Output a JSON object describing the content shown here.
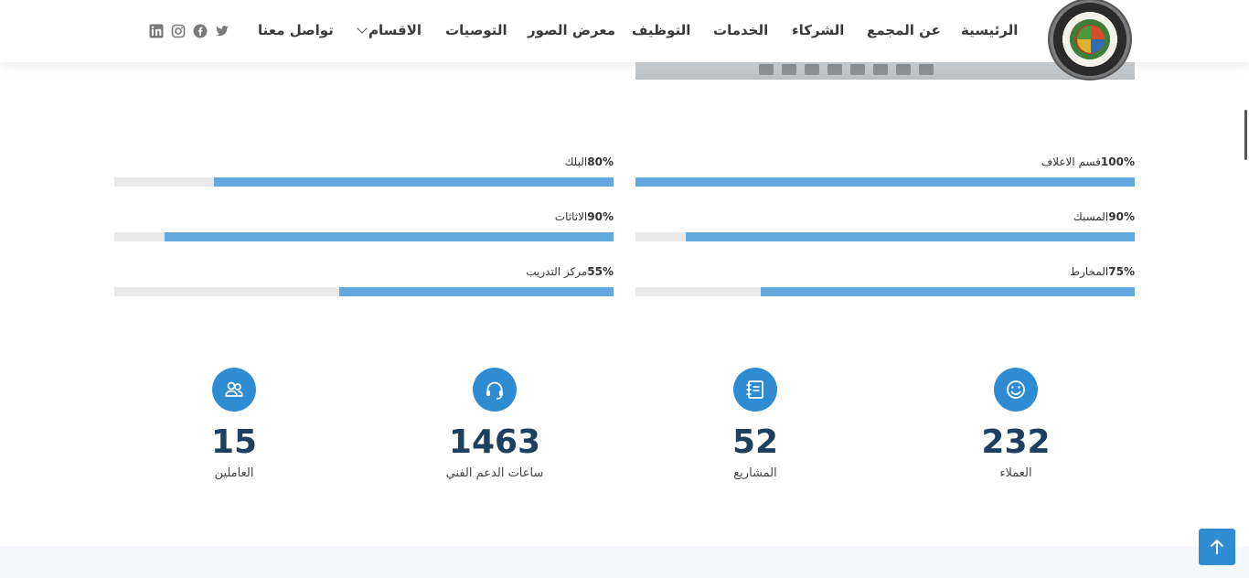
{
  "nav": {
    "home": "الرئيسية",
    "about": "عن المجمع",
    "partners": "الشركاء",
    "services": "الخدمات",
    "jobs": "التوظيف",
    "gallery": "معرض الصور",
    "recommendations": "التوصيات",
    "sections": "الاقسام",
    "contact": "تواصل معنا"
  },
  "logo": {
    "alt_text": "ATBARA PRODUCTION HALLS"
  },
  "social": [
    "twitter-icon",
    "facebook-icon",
    "instagram-icon",
    "linkedin-icon"
  ],
  "skills": [
    {
      "label": "قسم الاعلاف",
      "percent_text": "100%",
      "percent": 100
    },
    {
      "label": "البلك",
      "percent_text": "80%",
      "percent": 80
    },
    {
      "label": "المسبك",
      "percent_text": "90%",
      "percent": 90
    },
    {
      "label": "الاثاثات",
      "percent_text": "90%",
      "percent": 90
    },
    {
      "label": "المخارط",
      "percent_text": "75%",
      "percent": 75
    },
    {
      "label": "مركز التدريب",
      "percent_text": "55%",
      "percent": 55
    }
  ],
  "counters": [
    {
      "value": "232",
      "label": "العملاء",
      "icon": "smile-icon"
    },
    {
      "value": "52",
      "label": "المشاريع",
      "icon": "journal-icon"
    },
    {
      "value": "1463",
      "label": "ساعات الدعم الفني",
      "icon": "headset-icon"
    },
    {
      "value": "15",
      "label": "العاملين",
      "icon": "people-icon"
    }
  ],
  "colors": {
    "accent": "#2f8cd3",
    "bar": "#62a9e0",
    "number": "#1d3f60"
  }
}
